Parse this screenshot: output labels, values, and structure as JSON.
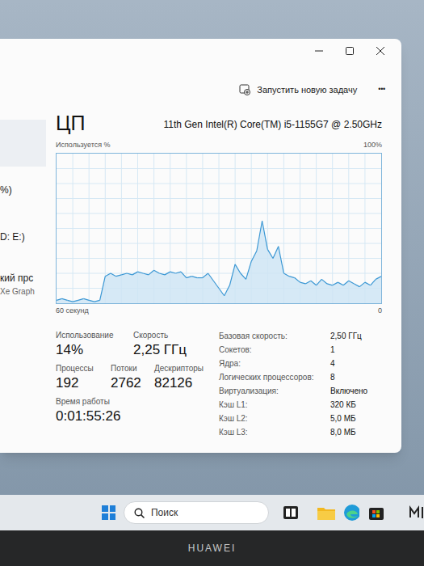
{
  "sidebar": {
    "items": [
      {
        "lines": [],
        "selected": true
      },
      {
        "lines": [
          "%)"
        ],
        "selected": false
      },
      {
        "lines": [
          "D: E:)"
        ],
        "selected": false
      },
      {
        "lines": [
          "кий прс",
          "Xe Graph"
        ],
        "selected": false
      }
    ]
  },
  "command_bar": {
    "new_task": "Запустить новую задачу",
    "more": "•••"
  },
  "header": {
    "title": "ЦП",
    "model": "11th Gen Intel(R) Core(TM) i5-1155G7 @ 2.50GHz"
  },
  "chart": {
    "y_label": "Используется %",
    "y_max": "100%",
    "x_start": "60 секунд",
    "x_end": "0",
    "series": [
      {
        "name": "usage",
        "values": [
          2,
          3,
          2,
          1,
          2,
          3,
          2,
          1,
          2,
          18,
          20,
          18,
          19,
          20,
          19,
          21,
          20,
          19,
          22,
          20,
          19,
          21,
          20,
          21,
          17,
          18,
          17,
          17,
          20,
          15,
          10,
          5,
          12,
          26,
          20,
          16,
          28,
          35,
          55,
          36,
          30,
          38,
          20,
          18,
          17,
          14,
          13,
          15,
          12,
          16,
          13,
          12,
          14,
          12,
          15,
          13,
          11,
          14,
          12,
          16,
          18
        ]
      }
    ]
  },
  "stat_rows": [
    [
      {
        "label": "Использование",
        "value": "14%"
      },
      {
        "label": "Скорость",
        "value": "2,25 ГГц"
      }
    ],
    [
      {
        "label": "Процессы",
        "value": "192"
      },
      {
        "label": "Потоки",
        "value": "2762"
      },
      {
        "label": "Дескрипторы",
        "value": "82126"
      }
    ],
    [
      {
        "label": "Время работы",
        "value": "0:01:55:26"
      }
    ]
  ],
  "details": [
    {
      "label": "Базовая скорость:",
      "value": "2,50 ГГц"
    },
    {
      "label": "Сокетов:",
      "value": "1"
    },
    {
      "label": "Ядра:",
      "value": "4"
    },
    {
      "label": "Логических процессоров:",
      "value": "8"
    },
    {
      "label": "Виртуализация:",
      "value": "Включено"
    },
    {
      "label": "Кэш L1:",
      "value": "320 КБ"
    },
    {
      "label": "Кэш L2:",
      "value": "5,0 МБ"
    },
    {
      "label": "Кэш L3:",
      "value": "8,0 МБ"
    }
  ],
  "taskbar": {
    "search_placeholder": "Поиск"
  },
  "bezel": {
    "brand": "HUAWEI"
  }
}
